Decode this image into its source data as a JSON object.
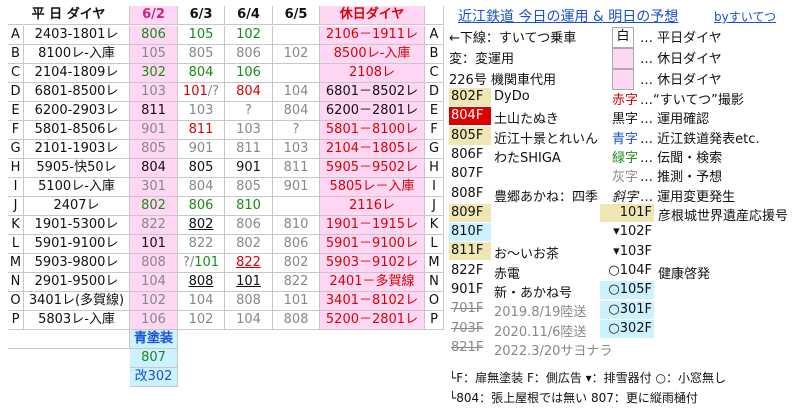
{
  "header": {
    "schedule": "平 日 ダイヤ",
    "days": [
      "6/2",
      "6/3",
      "6/4",
      "6/5"
    ],
    "holiday": "休日ダイヤ"
  },
  "rows": [
    {
      "id": "A",
      "wd": "2403-1801レ",
      "d": [
        {
          "t": "806",
          "c": "gr"
        },
        {
          "t": "105",
          "c": "gr"
        },
        {
          "t": "102",
          "c": "gr"
        },
        {
          "t": "",
          "c": ""
        }
      ],
      "hol": "2106－1911レ",
      "holc": "rd",
      "id2": "A"
    },
    {
      "id": "B",
      "wd": "8100レ-入庫",
      "d": [
        {
          "t": "105",
          "c": "g"
        },
        {
          "t": "805",
          "c": "g"
        },
        {
          "t": "806",
          "c": "g"
        },
        {
          "t": "102",
          "c": "g"
        }
      ],
      "hol": "8500レ-入庫",
      "holc": "rd",
      "id2": "B"
    },
    {
      "id": "C",
      "wd": "2104-1809レ",
      "d": [
        {
          "t": "302",
          "c": "gr"
        },
        {
          "t": "804",
          "c": "gr"
        },
        {
          "t": "106",
          "c": "gr"
        },
        {
          "t": "",
          "c": ""
        }
      ],
      "hol": "2108レ",
      "holc": "rd",
      "id2": "C"
    },
    {
      "id": "D",
      "wd": "6801-8500レ",
      "d": [
        {
          "t": "103",
          "c": "g"
        },
        {
          "t": "101/?",
          "c": "mix1"
        },
        {
          "t": "804",
          "c": "rd"
        },
        {
          "t": "104",
          "c": "g"
        }
      ],
      "hol": "6801－8502レ",
      "holc": "bk",
      "id2": "D"
    },
    {
      "id": "E",
      "wd": "6200-2903レ",
      "d": [
        {
          "t": "811",
          "c": "bk"
        },
        {
          "t": "103",
          "c": "g"
        },
        {
          "t": "?",
          "c": "g"
        },
        {
          "t": "804",
          "c": "g"
        }
      ],
      "hol": "6200－2801レ",
      "holc": "bk",
      "id2": "E"
    },
    {
      "id": "F",
      "wd": "5801-8506レ",
      "d": [
        {
          "t": "901",
          "c": "g"
        },
        {
          "t": "811",
          "c": "rd"
        },
        {
          "t": "103",
          "c": "g"
        },
        {
          "t": "?",
          "c": "g"
        }
      ],
      "hol": "5801－8100レ",
      "holc": "rd",
      "id2": "F"
    },
    {
      "id": "G",
      "wd": "2101-1903レ",
      "d": [
        {
          "t": "805",
          "c": "g"
        },
        {
          "t": "901",
          "c": "g"
        },
        {
          "t": "811",
          "c": "g"
        },
        {
          "t": "103",
          "c": "g"
        }
      ],
      "hol": "2104－1805レ",
      "holc": "rd",
      "id2": "G"
    },
    {
      "id": "H",
      "wd": "5905-快50レ",
      "d": [
        {
          "t": "804",
          "c": "bk"
        },
        {
          "t": "805",
          "c": "bk"
        },
        {
          "t": "901",
          "c": "bk"
        },
        {
          "t": "811",
          "c": "g"
        }
      ],
      "hol": "5905－9502レ",
      "holc": "rd",
      "id2": "H"
    },
    {
      "id": "I",
      "wd": "5100レ-入庫",
      "d": [
        {
          "t": "301",
          "c": "g"
        },
        {
          "t": "804",
          "c": "g"
        },
        {
          "t": "805",
          "c": "g"
        },
        {
          "t": "901",
          "c": "g"
        }
      ],
      "hol": "5805レ－入庫",
      "holc": "rd",
      "id2": "I"
    },
    {
      "id": "J",
      "wd": "2407レ",
      "d": [
        {
          "t": "802",
          "c": "gr"
        },
        {
          "t": "806",
          "c": "gr"
        },
        {
          "t": "810",
          "c": "gr"
        },
        {
          "t": "",
          "c": ""
        }
      ],
      "hol": "2116レ",
      "holc": "rd",
      "id2": "J"
    },
    {
      "id": "K",
      "wd": "1901-5300レ",
      "d": [
        {
          "t": "822",
          "c": "g"
        },
        {
          "t": "802",
          "c": "bku"
        },
        {
          "t": "806",
          "c": "g"
        },
        {
          "t": "810",
          "c": "g"
        }
      ],
      "hol": "1901－1915レ",
      "holc": "rd",
      "id2": "K"
    },
    {
      "id": "L",
      "wd": "5901-9100レ",
      "d": [
        {
          "t": "101",
          "c": "bk"
        },
        {
          "t": "822",
          "c": "g"
        },
        {
          "t": "802",
          "c": "g"
        },
        {
          "t": "806",
          "c": "g"
        }
      ],
      "hol": "5901－9100レ",
      "holc": "rd",
      "id2": "L"
    },
    {
      "id": "M",
      "wd": "5903-9800レ",
      "d": [
        {
          "t": "808",
          "c": "g"
        },
        {
          "t": "?/101",
          "c": "mix2"
        },
        {
          "t": "822",
          "c": "rdu"
        },
        {
          "t": "802",
          "c": "g"
        }
      ],
      "hol": "5903－9102レ",
      "holc": "rd",
      "id2": "M"
    },
    {
      "id": "N",
      "wd": "2901-9500レ",
      "d": [
        {
          "t": "104",
          "c": "g"
        },
        {
          "t": "808",
          "c": "bku"
        },
        {
          "t": "101",
          "c": "bku"
        },
        {
          "t": "822",
          "c": "g"
        }
      ],
      "hol": "2401－多賀線",
      "holc": "rd",
      "id2": "N"
    },
    {
      "id": "O",
      "wd": "3401レ(多賀線)",
      "d": [
        {
          "t": "102",
          "c": "g"
        },
        {
          "t": "104",
          "c": "g"
        },
        {
          "t": "808",
          "c": "g"
        },
        {
          "t": "101",
          "c": "g"
        }
      ],
      "hol": "3401－8102レ",
      "holc": "rd",
      "id2": "O"
    },
    {
      "id": "P",
      "wd": "5803レ-入庫",
      "d": [
        {
          "t": "106",
          "c": "g"
        },
        {
          "t": "102",
          "c": "g"
        },
        {
          "t": "104",
          "c": "g"
        },
        {
          "t": "808",
          "c": "g"
        }
      ],
      "hol": "5200－2801レ",
      "holc": "rd",
      "id2": "P"
    }
  ],
  "footer": {
    "label": "青塗装",
    "car1": "807",
    "car2": "改302"
  },
  "right": {
    "title": "近江鉄道 今日の運用 & 明日の予想",
    "by": "byすいてつ",
    "legend_left": [
      {
        "a": "←下線：すいてつ乗車"
      },
      {
        "a": "変：変運用"
      },
      {
        "a": "226号 機関車代用"
      }
    ],
    "legend_right": [
      {
        "k": "白",
        "v": "… 平日ダイヤ"
      },
      {
        "k": "",
        "v": "… 休日ダイヤ"
      },
      {
        "k": "",
        "v": "… 休日ダイヤ"
      }
    ],
    "cars": [
      {
        "n": "802F",
        "desc": "DyDo"
      },
      {
        "n": "804F",
        "desc": "土山たぬき"
      },
      {
        "n": "805F",
        "desc": "近江十景とれいん"
      },
      {
        "n": "806F",
        "desc": "わたSHIGA"
      },
      {
        "n": "807F",
        "desc": ""
      },
      {
        "n": "808F",
        "desc": "豊郷あかね：四季"
      },
      {
        "n": "809F",
        "desc": ""
      },
      {
        "n": "810F",
        "desc": ""
      },
      {
        "n": "811F",
        "desc": "お～いお茶"
      },
      {
        "n": "822F",
        "desc": "赤電"
      },
      {
        "n": "901F",
        "desc": "新・あかね号"
      },
      {
        "n": "701F",
        "desc": "2019.8/19陸送"
      },
      {
        "n": "703F",
        "desc": "2020.11/6陸送"
      },
      {
        "n": "821F",
        "desc": "2022.3/20サヨナラ"
      }
    ],
    "color_legend": [
      {
        "k": "赤字",
        "v": "…“すいてつ”撮影"
      },
      {
        "k": "黒字",
        "v": "… 運用確認"
      },
      {
        "k": "青字",
        "v": "… 近江鉄道発表etc."
      },
      {
        "k": "緑字",
        "v": "… 伝聞・検索"
      },
      {
        "k": "灰字",
        "v": "… 推測・予想"
      },
      {
        "k": "斜字",
        "v": "… 運用変更発生"
      }
    ],
    "small": [
      {
        "n": "101F",
        "desc": "彦根城世界遺産応援号"
      },
      {
        "n": "▾102F",
        "desc": ""
      },
      {
        "n": "▾103F",
        "desc": ""
      },
      {
        "n": "○104F",
        "desc": "健康啓発"
      },
      {
        "n": "○105F",
        "desc": ""
      },
      {
        "n": "○301F",
        "desc": ""
      },
      {
        "n": "○302F",
        "desc": ""
      }
    ],
    "note1": "└F：扉無塗装  F：側広告  ▾：排雪器付  ○：小窓無し",
    "note2": "└804：張上屋根では無い  807：更に縦雨樋付"
  },
  "colors": {
    "pink": "#ffd7f5",
    "green": "#1a8a1a",
    "red": "#dd0000",
    "gray": "#888888",
    "blue": "#1a4fd6",
    "lightblue": "#ccf2ff",
    "tan": "#f0e6b4"
  }
}
